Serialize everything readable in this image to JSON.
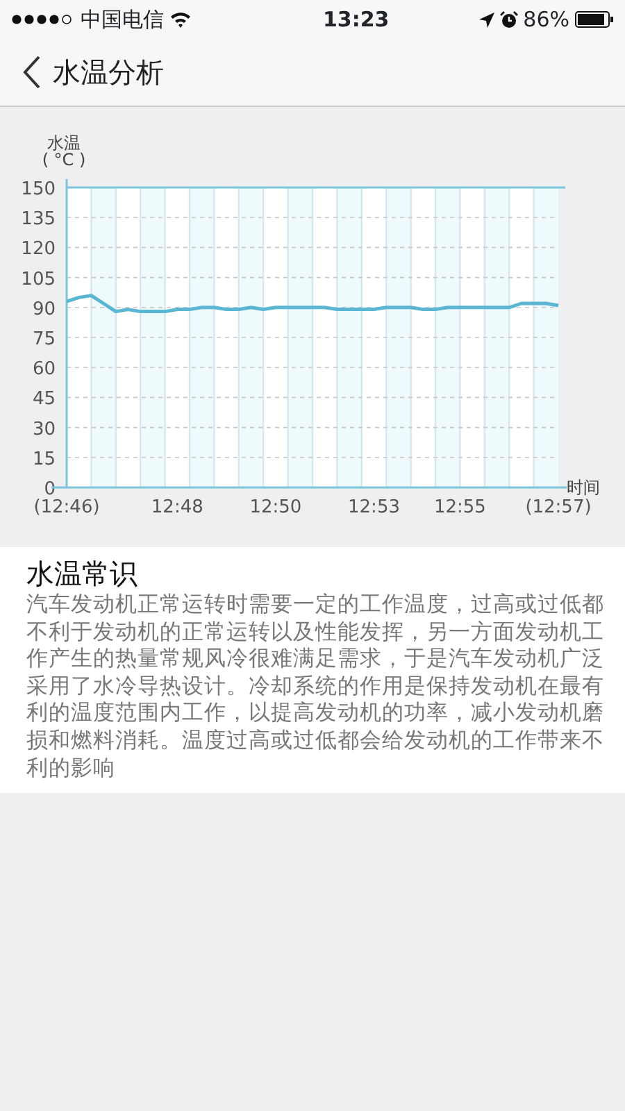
{
  "status_bar": {
    "carrier": "中国电信",
    "time": "13:23",
    "battery": "86%"
  },
  "nav": {
    "title": "水温分析"
  },
  "chart": {
    "chart_data": {
      "type": "line",
      "ylabel": "水温\n( °C )",
      "xlabel": "时间",
      "categories": [
        "(12:46)",
        null,
        null,
        null,
        null,
        null,
        null,
        null,
        null,
        "12:48",
        null,
        null,
        null,
        null,
        null,
        null,
        null,
        "12:50",
        null,
        null,
        null,
        null,
        null,
        null,
        null,
        "12:53",
        null,
        null,
        null,
        null,
        null,
        null,
        "12:55",
        null,
        null,
        null,
        null,
        null,
        null,
        null,
        "(12:57)"
      ],
      "series": [
        {
          "color": "#5ab6d2",
          "values": [
            93,
            95,
            96,
            92,
            88,
            89,
            88,
            88,
            88,
            89,
            89,
            90,
            90,
            89,
            89,
            90,
            89,
            90,
            90,
            90,
            90,
            90,
            89,
            89,
            89,
            89,
            90,
            90,
            90,
            89,
            89,
            90,
            90,
            90,
            90,
            90,
            90,
            92,
            92,
            92,
            91
          ]
        }
      ],
      "ylim": [
        0,
        150
      ],
      "grid": true,
      "yticks": [
        0,
        15,
        30,
        45,
        60,
        75,
        90,
        105,
        120,
        135,
        150
      ]
    }
  },
  "info": {
    "title": "水温常识",
    "text": "汽车发动机正常运转时需要一定的工作温度，过高或过低都不利于发动机的正常运转以及性能发挥，另一方面发动机工作产生的热量常规风冷很难满足需求，于是汽车发动机广泛采用了水冷导热设计。冷却系统的作用是保持发动机在最有利的温度范围内工作，以提高发动机的功率，减小发动机磨损和燃料消耗。温度过高或过低都会给发动机的工作带来不利的影响"
  }
}
